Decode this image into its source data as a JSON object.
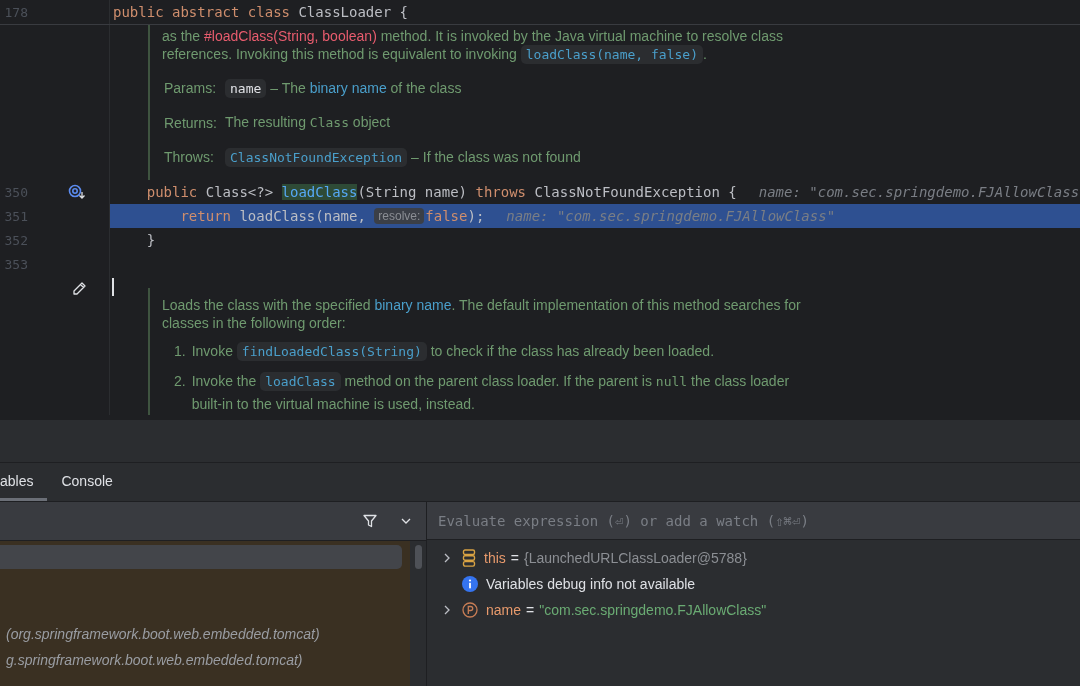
{
  "editor": {
    "sticky_line": {
      "number": "178",
      "tokens": [
        {
          "kind": "keyword",
          "text": "public abstract class "
        },
        {
          "kind": "plain",
          "text": "ClassLoader {"
        }
      ]
    },
    "doc_top": {
      "paragraph": [
        {
          "kind": "text",
          "text": "as the "
        },
        {
          "kind": "red-link",
          "text": "#loadClass(String, boolean)"
        },
        {
          "kind": "text",
          "text": " method. It is invoked by the Java virtual machine to resolve class references. Invoking this method is equivalent to invoking "
        },
        {
          "kind": "code",
          "text": "loadClass(name, false)"
        },
        {
          "kind": "text",
          "text": "."
        }
      ],
      "tags": [
        {
          "label": "Params:",
          "parts": [
            {
              "kind": "chip",
              "text": "name"
            },
            {
              "kind": "text",
              "text": " – The "
            },
            {
              "kind": "link",
              "text": "binary name"
            },
            {
              "kind": "text",
              "text": " of the class"
            }
          ]
        },
        {
          "label": "Returns:",
          "parts": [
            {
              "kind": "text",
              "text": "The resulting "
            },
            {
              "kind": "mono",
              "text": "Class"
            },
            {
              "kind": "text",
              "text": " object"
            }
          ]
        },
        {
          "label": "Throws:",
          "parts": [
            {
              "kind": "code",
              "text": "ClassNotFoundException"
            },
            {
              "kind": "text",
              "text": " – If the class was not found"
            }
          ]
        }
      ]
    },
    "lines": [
      {
        "number": "350",
        "marker": true,
        "current": false,
        "tokens": [
          {
            "kind": "keyword",
            "text": "    public "
          },
          {
            "kind": "plain",
            "text": "Class<?> "
          },
          {
            "kind": "method-decl",
            "text": "loadClass"
          },
          {
            "kind": "plain",
            "text": "(String name) "
          },
          {
            "kind": "keyword",
            "text": "throws "
          },
          {
            "kind": "plain",
            "text": "ClassNotFoundException {"
          },
          {
            "kind": "inline-value",
            "text": "name: \"com.sec.springdemo.FJAllowClass"
          }
        ]
      },
      {
        "number": "351",
        "marker": false,
        "current": true,
        "tokens": [
          {
            "kind": "keyword",
            "text": "        return "
          },
          {
            "kind": "plain",
            "text": "loadClass(name, "
          },
          {
            "kind": "hint",
            "text": "resolve:"
          },
          {
            "kind": "keyword",
            "text": "false"
          },
          {
            "kind": "plain",
            "text": ");"
          },
          {
            "kind": "inline-value",
            "text": "name: \"com.sec.springdemo.FJAllowClass\""
          }
        ]
      },
      {
        "number": "352",
        "marker": false,
        "current": false,
        "tokens": [
          {
            "kind": "plain",
            "text": "    }"
          }
        ]
      },
      {
        "number": "353",
        "marker": false,
        "current": false
      }
    ],
    "doc_bottom": {
      "editing": true,
      "paragraph": [
        {
          "kind": "text",
          "text": "Loads the class with the specified "
        },
        {
          "kind": "link",
          "text": "binary name"
        },
        {
          "kind": "text",
          "text": ". The default implementation of this method searches for classes in the following order:"
        }
      ],
      "list": [
        {
          "number": "1.",
          "parts": [
            {
              "kind": "text",
              "text": "Invoke "
            },
            {
              "kind": "code",
              "text": "findLoadedClass(String)"
            },
            {
              "kind": "text",
              "text": " to check if the class has already been loaded."
            }
          ]
        },
        {
          "number": "2.",
          "parts": [
            {
              "kind": "text",
              "text": "Invoke the "
            },
            {
              "kind": "code",
              "text": "loadClass"
            },
            {
              "kind": "text",
              "text": " method on the parent class loader. If the parent is "
            },
            {
              "kind": "mono",
              "text": "null"
            },
            {
              "kind": "text",
              "text": " the class loader built-in to the virtual machine is used, instead."
            }
          ]
        }
      ]
    }
  },
  "debug": {
    "tabs": [
      {
        "label": "ables",
        "selected": true
      },
      {
        "label": "Console",
        "selected": false
      }
    ],
    "frames": [
      {
        "selected": true
      },
      {
        "selected": false,
        "text": "(org.springframework.boot.web.embedded.tomcat)"
      },
      {
        "selected": false,
        "text": "g.springframework.boot.web.embedded.tomcat)"
      }
    ],
    "evaluate": {
      "placeholder": "Evaluate expression (⏎) or add a watch (⇧⌘⏎)"
    },
    "variables": [
      {
        "kind": "object",
        "expandable": true,
        "name": "this",
        "separator": "=",
        "value": "{LaunchedURLClassLoader@5788}"
      },
      {
        "kind": "info",
        "expandable": false,
        "text": "Variables debug info not available"
      },
      {
        "kind": "param",
        "expandable": true,
        "name": "name",
        "separator": "=",
        "value": "\"com.sec.springdemo.FJAllowClass\""
      }
    ]
  }
}
